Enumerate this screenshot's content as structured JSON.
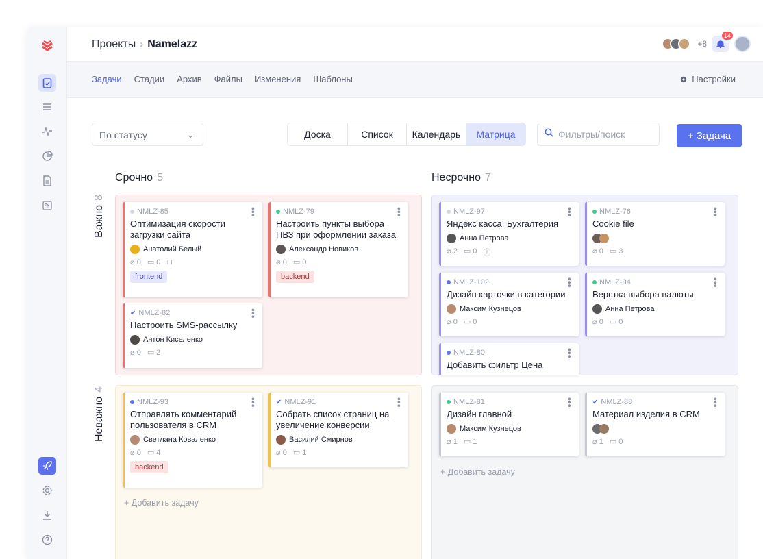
{
  "breadcrumb": {
    "root": "Проекты",
    "project": "Namelazz"
  },
  "header": {
    "more_users": "+8",
    "notifications": "14"
  },
  "tabs": [
    "Задачи",
    "Стадии",
    "Архив",
    "Файлы",
    "Изменения",
    "Шаблоны"
  ],
  "settings_label": "Настройки",
  "controls": {
    "group_by": "По статусу",
    "views": [
      "Доска",
      "Список",
      "Календарь",
      "Матрица"
    ],
    "search_placeholder": "Фильтры/поиск",
    "add_task": "+ Задача"
  },
  "columns": [
    {
      "label": "Срочно",
      "count": "5"
    },
    {
      "label": "Несрочно",
      "count": "7"
    }
  ],
  "rows": [
    {
      "label": "Важно",
      "count": "8"
    },
    {
      "label": "Неважно",
      "count": "4"
    }
  ],
  "add_task_label": "+ Добавить задачу",
  "cards": [
    {
      "id": "NMLZ-85",
      "title": "Оптимизация скорости загрузки сайта",
      "assignee": "Анатолий Белый",
      "files": "0",
      "comments": "0",
      "tag": "frontend"
    },
    {
      "id": "NMLZ-79",
      "title": "Настроить пункты выбора ПВЗ при оформлении заказа",
      "assignee": "Александр Новиков",
      "files": "0",
      "comments": "0",
      "tag": "backend"
    },
    {
      "id": "NMLZ-82",
      "title": "Настроить SMS-рассылку",
      "assignee": "Антон Киселенко",
      "files": "0",
      "comments": "2"
    },
    {
      "id": "NMLZ-97",
      "title": "Яндекс касса. Бухгалтерия",
      "assignee": "Анна Петрова",
      "files": "2",
      "comments": "0"
    },
    {
      "id": "NMLZ-76",
      "title": "Cookie file",
      "files": "0",
      "comments": "3"
    },
    {
      "id": "NMLZ-102",
      "title": "Дизайн карточки в категории",
      "assignee": "Максим Кузнецов",
      "files": "0",
      "comments": "0"
    },
    {
      "id": "NMLZ-94",
      "title": "Верстка выбора валюты",
      "assignee": "Анна Петрова",
      "files": "0",
      "comments": "0"
    },
    {
      "id": "NMLZ-80",
      "title": "Добавить фильтр Цена"
    },
    {
      "id": "NMLZ-93",
      "title": "Отправлять комментарий пользователя в CRM",
      "assignee": "Светлана Коваленко",
      "files": "0",
      "comments": "4",
      "tag": "backend"
    },
    {
      "id": "NMLZ-91",
      "title": "Собрать список страниц на увеличение конверсии",
      "assignee": "Василий Смирнов",
      "files": "0",
      "comments": "1"
    },
    {
      "id": "NMLZ-81",
      "title": "Дизайн главной",
      "assignee": "Максим Кузнецов",
      "files": "1",
      "comments": "1"
    },
    {
      "id": "NMLZ-88",
      "title": "Материал изделия в CRM",
      "files": "1",
      "comments": "0"
    }
  ],
  "colors": {
    "accent": "#5b72ef",
    "urgent_bg": "#fdf0f0",
    "urgent_border": "#f5cfcf",
    "nonurgent_bg": "#f1f1fb",
    "low_bg": "#fef9ef",
    "grey_bg": "#f4f5f7"
  }
}
